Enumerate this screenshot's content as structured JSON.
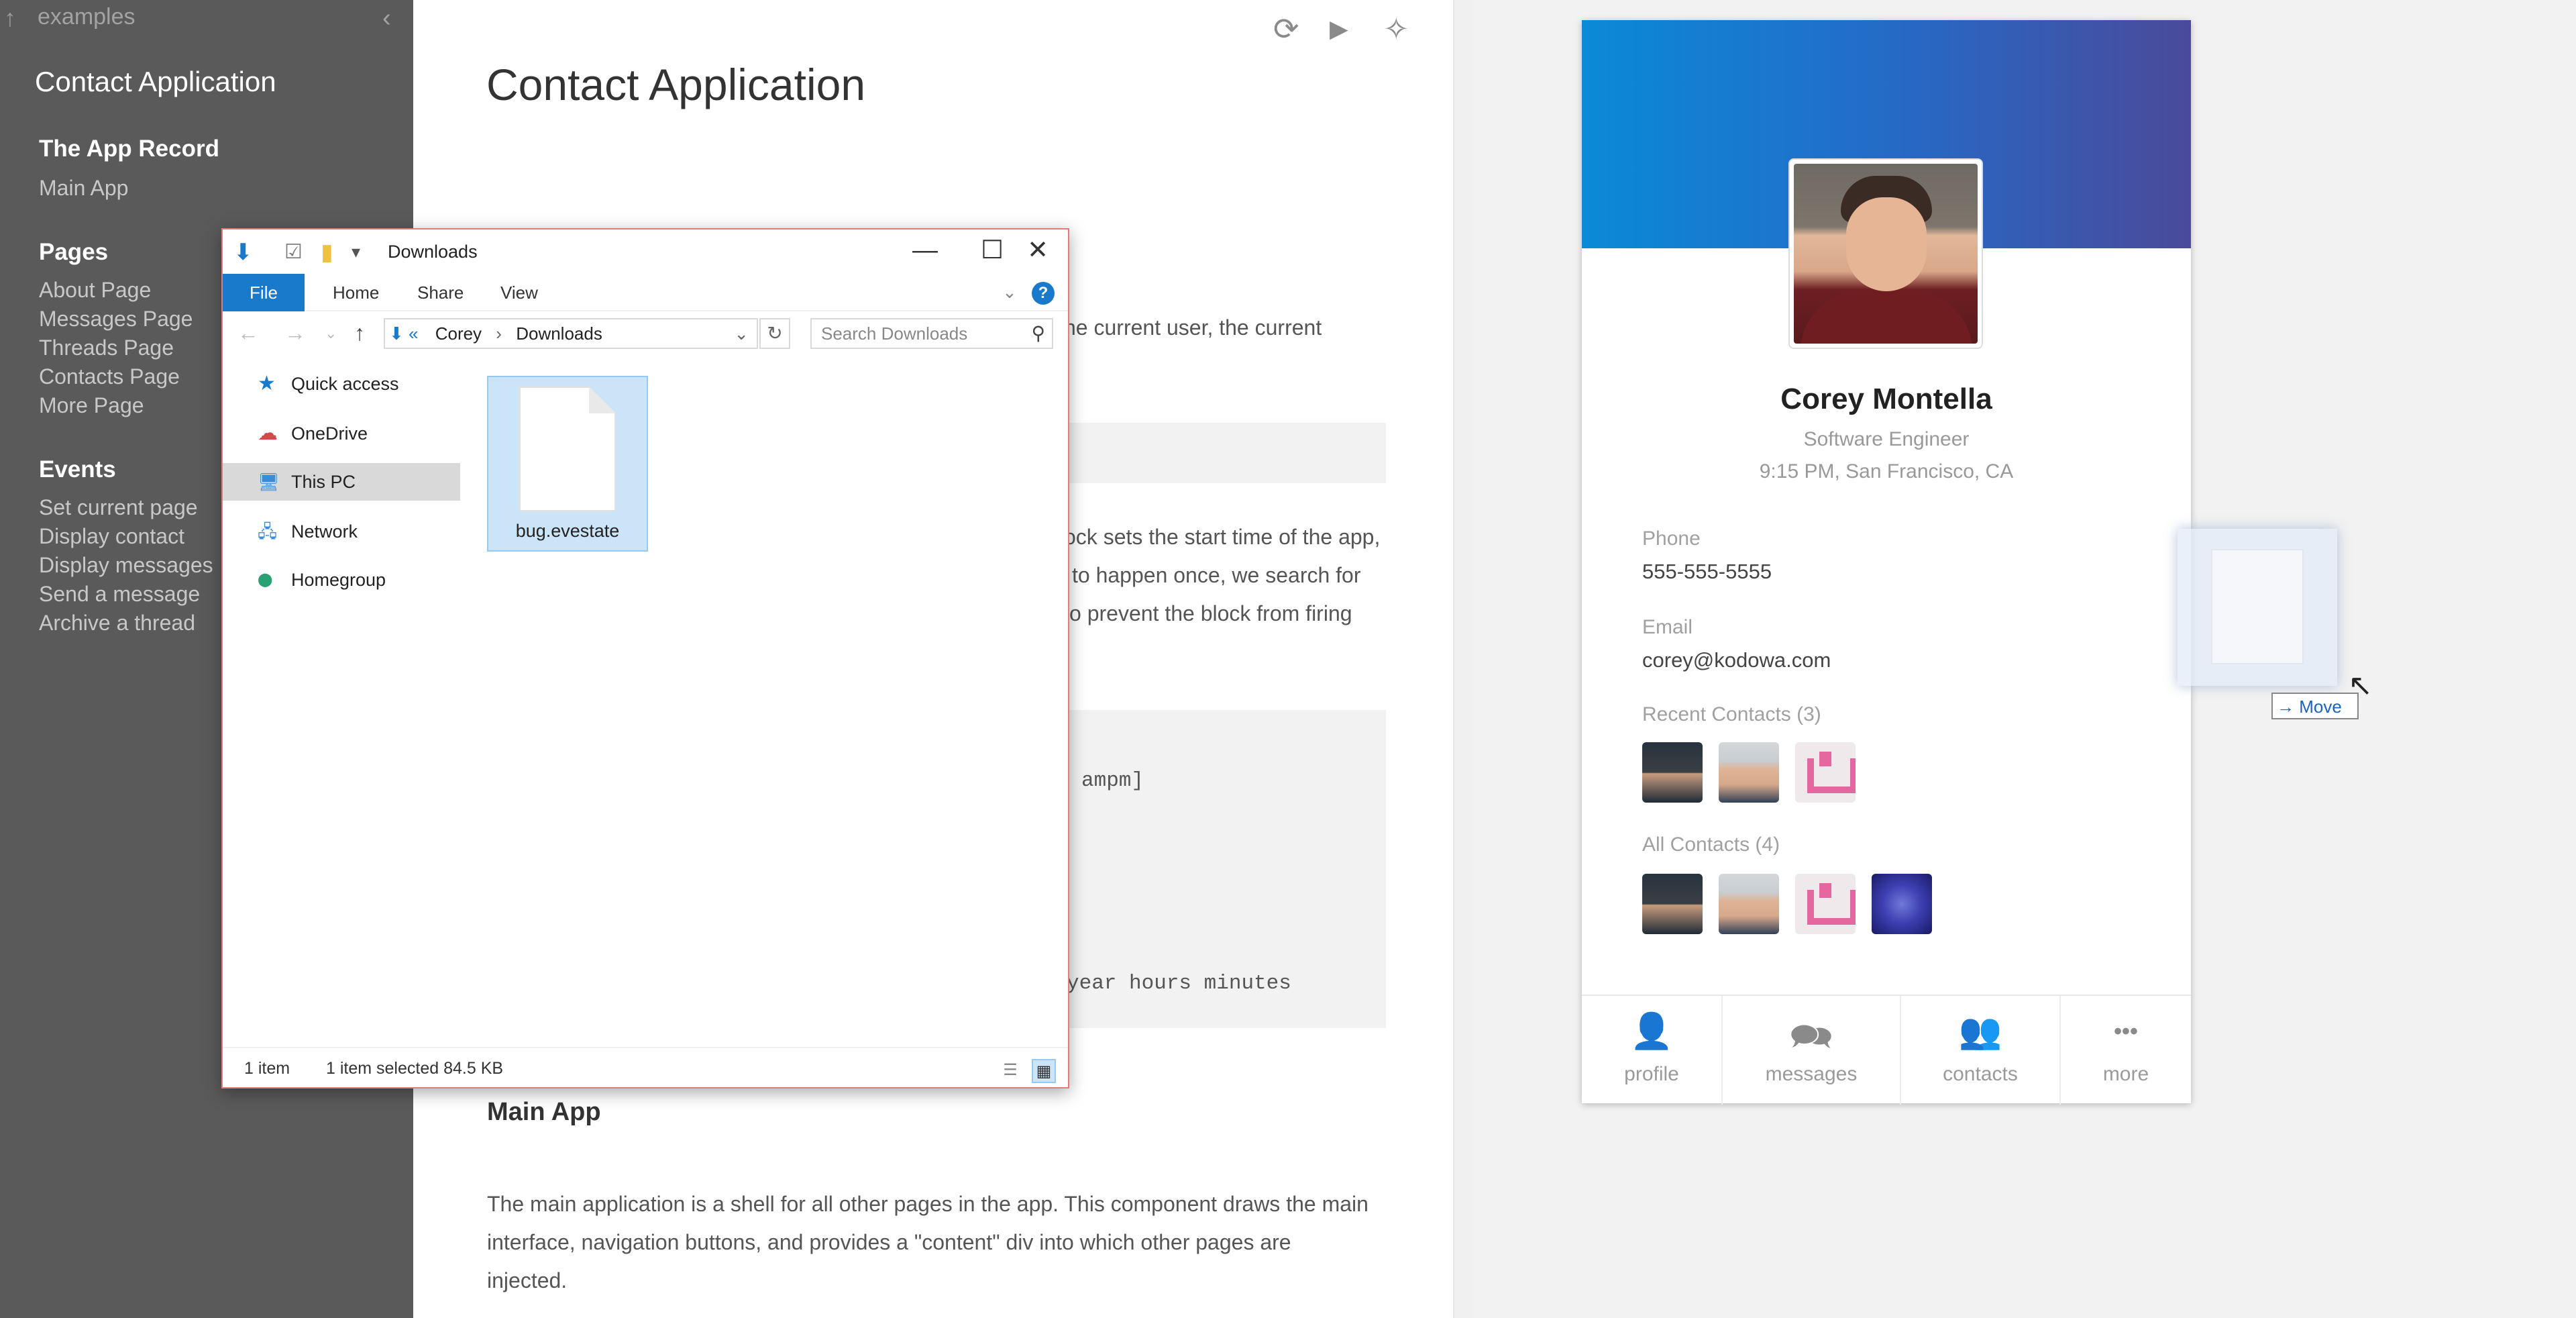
{
  "sidebar": {
    "up_arrow": "↑",
    "breadcrumb": "examples",
    "collapse": "‹",
    "title": "Contact Application",
    "sections": [
      {
        "heading": "The App Record",
        "links": [
          "Main App"
        ]
      },
      {
        "heading": "Pages",
        "links": [
          "About Page",
          "Messages Page",
          "Threads Page",
          "Contacts Page",
          "More Page"
        ]
      },
      {
        "heading": "Events",
        "links": [
          "Set current page",
          "Display contact",
          "Display messages",
          "Send a message",
          "Archive a thread"
        ]
      }
    ]
  },
  "doc": {
    "toolbar": {
      "refresh_icon": "⟳",
      "run_icon": "▶",
      "magic_icon": "✧"
    },
    "title": "Contact Application",
    "lines": [
      "he current user, the current",
      "ock sets the start time of the app,",
      "to happen once, we search for",
      "o prevent the block from firing"
    ],
    "code_lines": [
      "ampm]",
      "year hours minutes"
    ],
    "main_app_heading": "Main App",
    "main_app_text": [
      "The main application is a shell for all other pages in the app. This component draws the main",
      "interface, navigation buttons, and provides a \"content\" div into which other pages are",
      "injected."
    ]
  },
  "profile": {
    "name": "Corey Montella",
    "role": "Software Engineer",
    "location": "9:15 PM, San Francisco, CA",
    "phone_label": "Phone",
    "phone": "555-555-5555",
    "email_label": "Email",
    "email": "corey@kodowa.com",
    "recent_label": "Recent Contacts (3)",
    "all_label": "All Contacts (4)",
    "header_colors": [
      "#0a8ad8",
      "#4b4a9a"
    ],
    "tabs": [
      {
        "icon": "person-icon",
        "glyph": "👤",
        "label": "profile"
      },
      {
        "icon": "messages-icon",
        "glyph": "🗪",
        "label": "messages"
      },
      {
        "icon": "contacts-icon",
        "glyph": "👥",
        "label": "contacts"
      },
      {
        "icon": "more-icon",
        "glyph": "•••",
        "label": "more"
      }
    ]
  },
  "drag": {
    "tooltip": "→ Move",
    "cursor": "↖"
  },
  "explorer": {
    "title": "Downloads",
    "quick_icons": [
      "⬇",
      "☑",
      "▮",
      "▾"
    ],
    "window_buttons": {
      "minimize": "—",
      "maximize": "☐",
      "close": "✕"
    },
    "ribbon_tabs": [
      "File",
      "Home",
      "Share",
      "View"
    ],
    "ribbon_expand": "⌄",
    "help": "?",
    "nav": {
      "back": "←",
      "forward": "→",
      "recent": "⌄",
      "up": "↑"
    },
    "address": {
      "prefix": "⬇ «",
      "path": [
        "Corey",
        "Downloads"
      ],
      "separator": "›",
      "dropdown": "⌄"
    },
    "refresh": "↻",
    "search_placeholder": "Search Downloads",
    "search_icon": "⚲",
    "tree": [
      {
        "icon": "star-icon",
        "glyph": "★",
        "label": "Quick access",
        "color": "#1979ca"
      },
      {
        "icon": "onedrive-icon",
        "glyph": "☁",
        "label": "OneDrive",
        "color": "#d44a4a"
      },
      {
        "icon": "pc-icon",
        "glyph": "🖥",
        "label": "This PC",
        "color": "#3a8bd6",
        "selected": true
      },
      {
        "icon": "network-icon",
        "glyph": "🖧",
        "label": "Network",
        "color": "#3a8bd6"
      },
      {
        "icon": "homegroup-icon",
        "glyph": "⬤",
        "label": "Homegroup",
        "color": "#2aa172"
      }
    ],
    "file": {
      "name": "bug.evestate"
    },
    "status": {
      "count": "1 item",
      "selected": "1 item selected  84.5 KB"
    },
    "view_buttons": [
      "☰",
      "▦"
    ]
  }
}
